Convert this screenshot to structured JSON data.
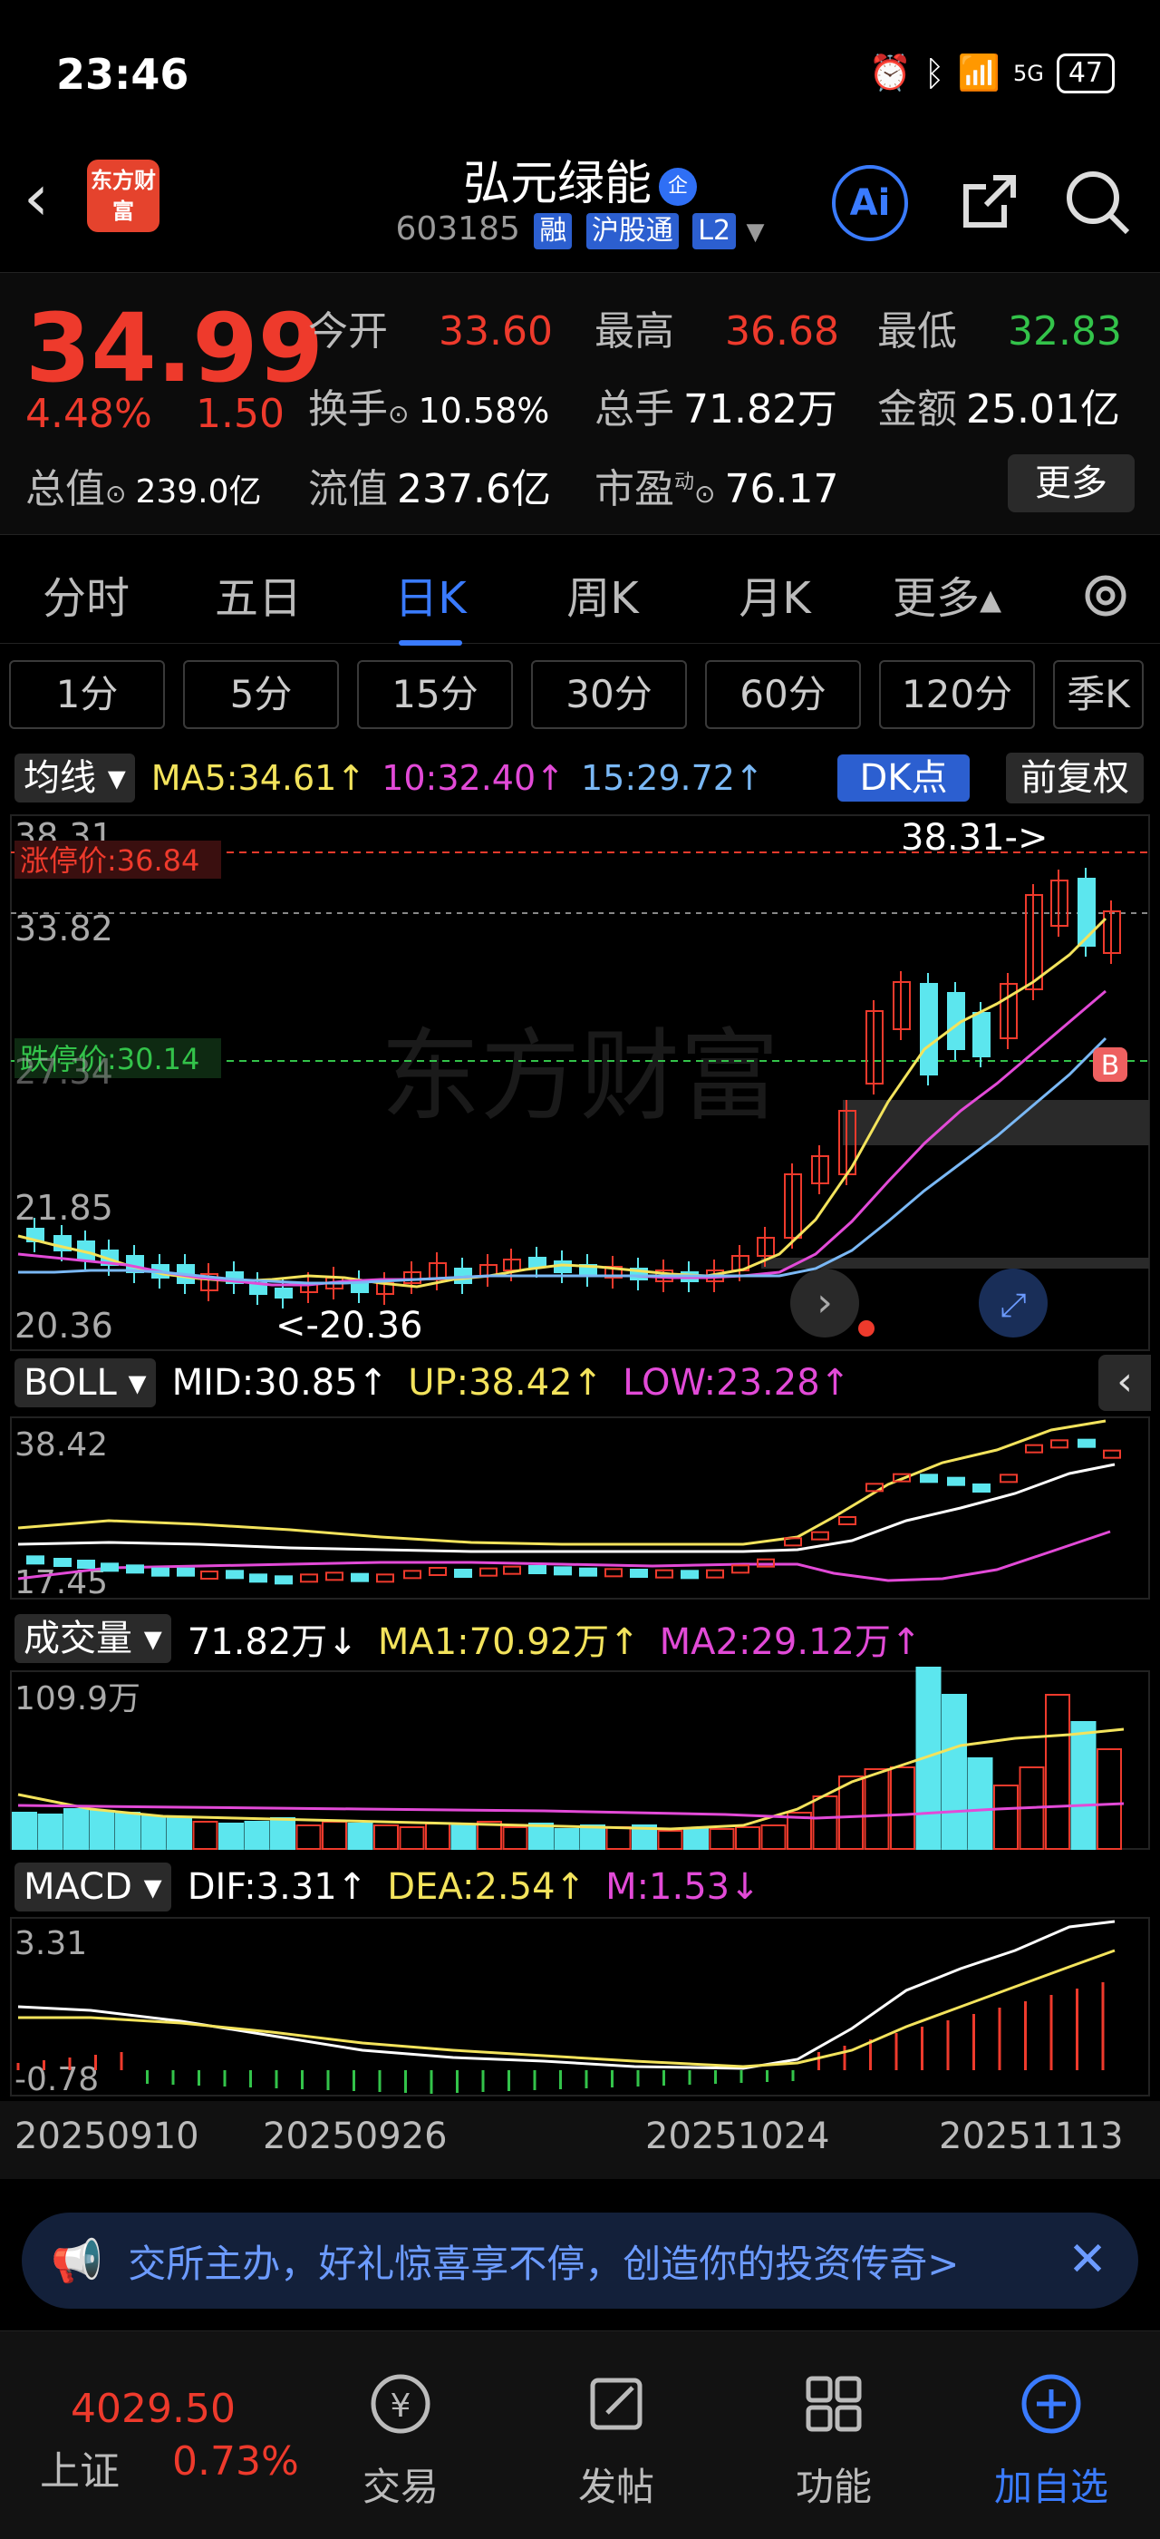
{
  "status": {
    "time": "23:46",
    "network": "5G",
    "battery": "47"
  },
  "header": {
    "stock_name": "弘元绿能",
    "qi_badge": "企",
    "code": "603185",
    "tags": [
      "融",
      "沪股通",
      "L2"
    ],
    "logo_text": "东方财富",
    "ai_label": "Ai"
  },
  "quote": {
    "price": "34.99",
    "pct": "4.48%",
    "change": "1.50",
    "open_label": "今开",
    "open": "33.60",
    "high_label": "最高",
    "high": "36.68",
    "low_label": "最低",
    "low": "32.83",
    "turnover_label": "换手",
    "turnover": "10.58%",
    "volume_label": "总手",
    "volume": "71.82万",
    "amount_label": "金额",
    "amount": "25.01亿",
    "mktcap_label": "总值",
    "mktcap": "239.0亿",
    "float_label": "流值",
    "float": "237.6亿",
    "pe_label": "市盈",
    "pe_sup": "动",
    "pe": "76.17",
    "more_label": "更多"
  },
  "tabs": [
    "分时",
    "五日",
    "日K",
    "周K",
    "月K",
    "更多▴"
  ],
  "periods": [
    "1分",
    "5分",
    "15分",
    "30分",
    "60分",
    "120分",
    "季K"
  ],
  "ma": {
    "selector": "均线",
    "ma5": "MA5:34.61↑",
    "ma10": "10:32.40↑",
    "ma15": "15:29.72↑",
    "dk": "DK点",
    "adjust": "前复权"
  },
  "kline": {
    "price_high_label": "38.31",
    "limit_up": "涨停价:36.84",
    "p2": "33.82",
    "limit_down": "跌停价:30.14",
    "p3": "27.34",
    "p4": "21.85",
    "price_low_label": "20.36",
    "peak_note": "38.31->",
    "trough_note": "<-20.36",
    "buy_mark": "B",
    "watermark": "东方财富"
  },
  "boll": {
    "selector": "BOLL",
    "mid": "MID:30.85↑",
    "up": "UP:38.42↑",
    "low": "LOW:23.28↑",
    "top": "38.42",
    "bottom": "17.45"
  },
  "vol": {
    "selector": "成交量",
    "value": "71.82万↓",
    "ma1": "MA1:70.92万↑",
    "ma2": "MA2:29.12万↑",
    "top": "109.9万"
  },
  "macd": {
    "selector": "MACD",
    "dif": "DIF:3.31↑",
    "dea": "DEA:2.54↑",
    "m": "M:1.53↓",
    "top": "3.31",
    "bottom": "-0.78"
  },
  "dates": [
    "20250910",
    "20250926",
    "20251024",
    "20251113"
  ],
  "banner": {
    "text": "交所主办，好礼惊喜享不停，创造你的投资传奇>"
  },
  "bottom": {
    "index_value": "4029.50",
    "index_name": "上证",
    "index_pct": "0.73%",
    "nav": [
      "交易",
      "发帖",
      "功能",
      "加自选"
    ]
  },
  "colors": {
    "up": "#ee3a2c",
    "down": "#5ce6ee",
    "accent": "#3a7bff",
    "ma5": "#f3e35c",
    "ma10": "#e24ad7",
    "ma15": "#7ab8f5"
  }
}
